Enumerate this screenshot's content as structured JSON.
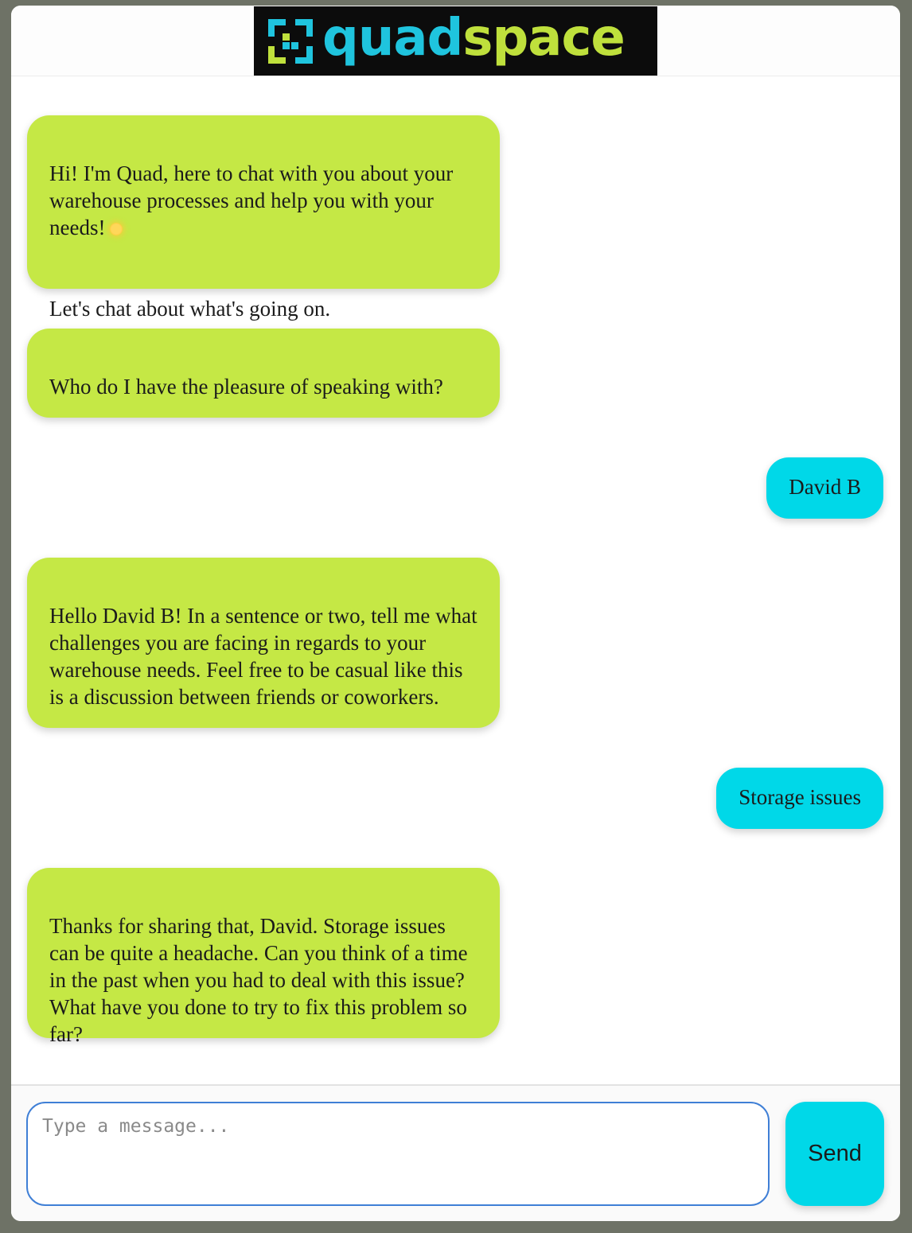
{
  "header": {
    "logo_text_quad": "quad",
    "logo_text_space": "space",
    "logo_icon": "quadspace-logo-mark",
    "colors": {
      "cyan": "#1fc4de",
      "lime": "#bfe03c",
      "background": "#0c0c0c"
    }
  },
  "messages": [
    {
      "sender": "bot",
      "text": "Hi! I'm Quad, here to chat with you about your warehouse processes and help you with your needs!",
      "emoji": "sun-icon",
      "text2": "Let's chat about what's going on."
    },
    {
      "sender": "bot",
      "text": "Who do I have the pleasure of speaking with?"
    },
    {
      "sender": "user",
      "text": "David B"
    },
    {
      "sender": "bot",
      "text": "Hello David B! In a sentence or two, tell me what challenges you are facing in regards to your warehouse needs. Feel free to be casual like this is a discussion between friends or coworkers."
    },
    {
      "sender": "user",
      "text": "Storage issues"
    },
    {
      "sender": "bot",
      "text": "Thanks for sharing that, David. Storage issues can be quite a headache. Can you think of a time in the past when you had to deal with this issue? What have you done to try to fix this problem so far?"
    }
  ],
  "composer": {
    "placeholder": "Type a message...",
    "value": "",
    "send_label": "Send"
  },
  "colors": {
    "bot_bubble": "#c5e845",
    "user_bubble": "#00d8e8",
    "input_border": "#3f7fd6"
  }
}
